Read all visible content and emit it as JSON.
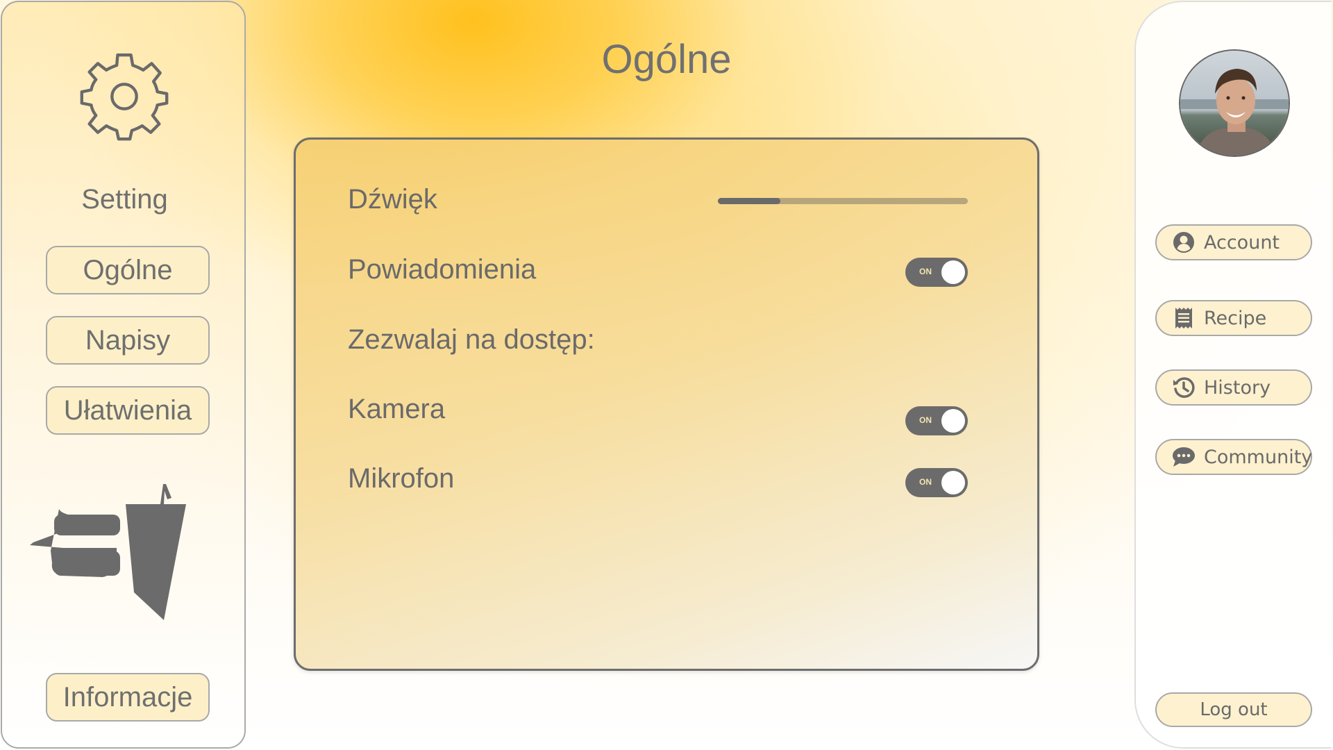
{
  "sidebar": {
    "title": "Setting",
    "menu": [
      "Ogólne",
      "Napisy",
      "Ułatwienia"
    ],
    "info_label": "Informacje"
  },
  "page": {
    "title": "Ogólne"
  },
  "settings": {
    "sound_label": "Dźwięk",
    "sound_level": 0.25,
    "notifications_label": "Powiadomienia",
    "notifications_state": "ON",
    "access_label": "Zezwalaj na dostęp:",
    "camera_label": "Kamera",
    "camera_state": "ON",
    "microphone_label": "Mikrofon",
    "microphone_state": "ON"
  },
  "nav": {
    "account": "Account",
    "recipe": "Recipe",
    "history": "History",
    "community": "Community",
    "logout": "Log out"
  },
  "colors": {
    "accent": "#ffc21a",
    "toggle_on": "#6b6b6b",
    "button_fill": "#fdf0c8"
  }
}
